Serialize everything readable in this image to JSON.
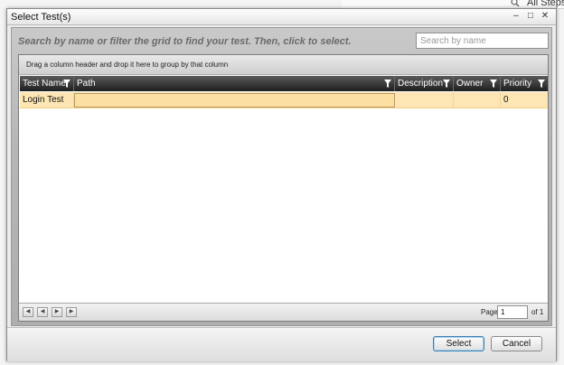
{
  "background": {
    "all_steps_label": "All Steps"
  },
  "dialog": {
    "title": "Select Test(s)",
    "window_controls": [
      "minimize",
      "maximize",
      "close"
    ],
    "instruction": "Search by name or filter the grid to find your test. Then, click to select.",
    "search": {
      "placeholder": "Search by name",
      "value": ""
    }
  },
  "grid": {
    "group_panel_text": "Drag a column header and drop it here to group by that column",
    "columns": [
      "Test Name",
      "Path",
      "Description",
      "Owner",
      "Priority"
    ],
    "rows": [
      {
        "name": "Login Test",
        "path": "",
        "description": "",
        "owner": "",
        "priority": "0"
      }
    ],
    "pager": {
      "page_label": "Page",
      "page_value": "1",
      "of_label": "of 1"
    }
  },
  "footer": {
    "select_label": "Select",
    "cancel_label": "Cancel"
  },
  "colors": {
    "selected_row": "#fde6b3",
    "header_bg": "#2b2b2b",
    "primary_border": "#3c7fb1"
  }
}
